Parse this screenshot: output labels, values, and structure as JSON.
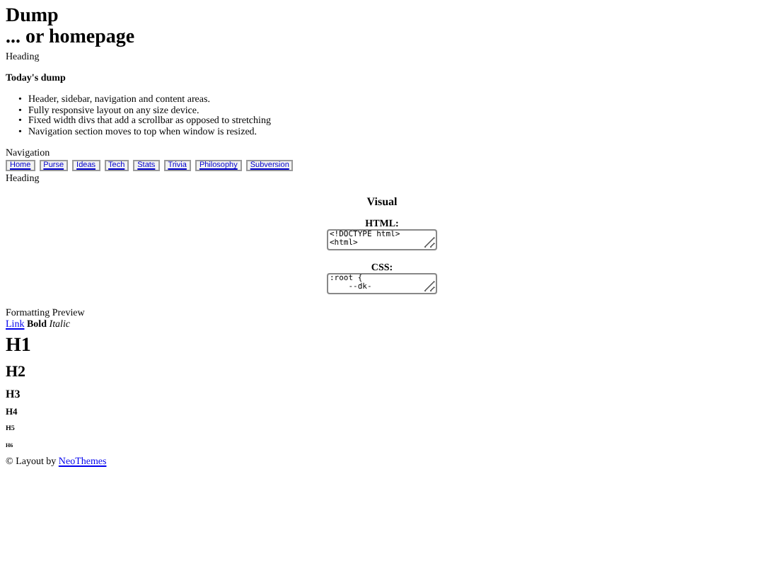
{
  "header": {
    "title": "Dump",
    "subtitle": "... or homepage"
  },
  "sidebar": {
    "heading": "Heading",
    "section_title": "Today's dump",
    "items": [
      {
        "marker": "•",
        "text": "Header, sidebar, navigation and content areas."
      },
      {
        "marker": "•",
        "text": "Fully responsive layout on any size device."
      },
      {
        "marker": "•",
        "text": "Fixed width divs that add a scrollbar as opposed to stretching"
      },
      {
        "marker": "•",
        "text": "Navigation section moves to top when window is resized."
      }
    ]
  },
  "navigation": {
    "label": "Navigation",
    "buttons": [
      "Home",
      "Purse",
      "Ideas",
      "Tech",
      "Stats",
      "Trivia",
      "Philosophy",
      "Subversion"
    ]
  },
  "content": {
    "heading": "Heading",
    "visual_title": "Visual",
    "editors": [
      {
        "label": "HTML:",
        "value": "<!DOCTYPE html>\n<html>"
      },
      {
        "label": "CSS:",
        "value": ":root {\n    --dk-"
      }
    ]
  },
  "preview": {
    "label": "Formatting Preview",
    "link": "Link",
    "bold": "Bold",
    "italic": "Italic",
    "headings": [
      "H1",
      "H2",
      "H3",
      "H4",
      "H5",
      "H6"
    ]
  },
  "footer": {
    "text": "© Layout by",
    "link": "NeoThemes"
  }
}
